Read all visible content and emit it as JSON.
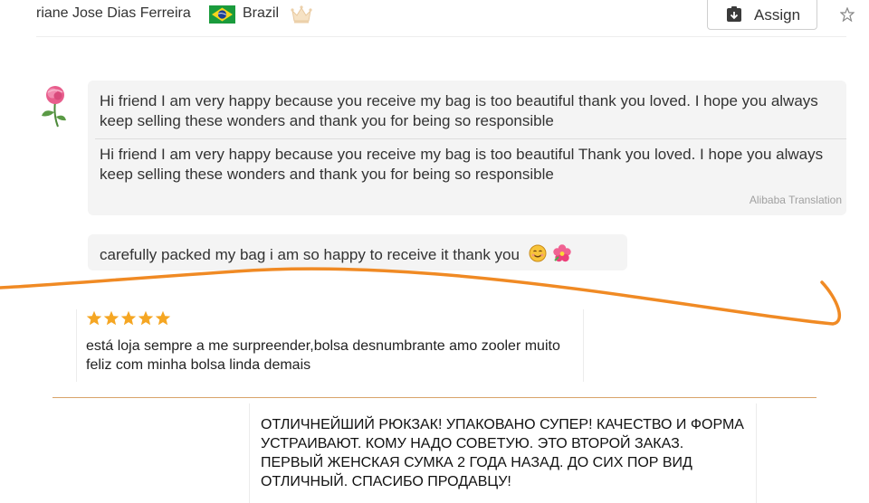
{
  "header": {
    "customer_name": "riane Jose Dias Ferreira",
    "country": "Brazil",
    "flag_icon": "brazil-flag-icon",
    "crown_icon": "crown-icon",
    "assign_label": "Assign",
    "assign_icon": "assign-icon"
  },
  "conversation": {
    "avatar_icon": "rose-icon",
    "message_1": {
      "text": "Hi friend I am very happy because you receive my bag is too beautiful thank you loved. I hope you always keep selling these wonders and thank you for being so responsible",
      "translation": "Hi friend I am very happy because you receive my bag is too beautiful Thank you loved. I hope you always keep selling these wonders and thank you for being so responsible",
      "translation_label": "Alibaba Translation"
    },
    "message_2": {
      "text": "carefully packed my bag i am so happy to receive it thank you",
      "emojis": [
        "smiling-face-icon",
        "hibiscus-icon"
      ]
    }
  },
  "reviews": [
    {
      "rating": 5,
      "text": "está loja sempre a me surpreender,bolsa desnumbrante amo zooler muito feliz com minha bolsa linda demais"
    },
    {
      "text": "ОТЛИЧНЕЙШИЙ РЮКЗАК! УПАКОВАНО СУПЕР! КАЧЕСТВО И ФОРМА УСТРАИВАЮТ. КОМУ НАДО СОВЕТУЮ. ЭТО ВТОРОЙ ЗАКАЗ. ПЕРВЫЙ ЖЕНСКАЯ СУМКА 2 ГОДА НАЗАД. ДО СИХ ПОР ВИД ОТЛИЧНЫЙ. СПАСИБО ПРОДАВЦУ!"
    }
  ],
  "colors": {
    "accent_orange": "#f08a24",
    "bubble_bg": "#f4f4f4",
    "star": "#f5a623"
  }
}
